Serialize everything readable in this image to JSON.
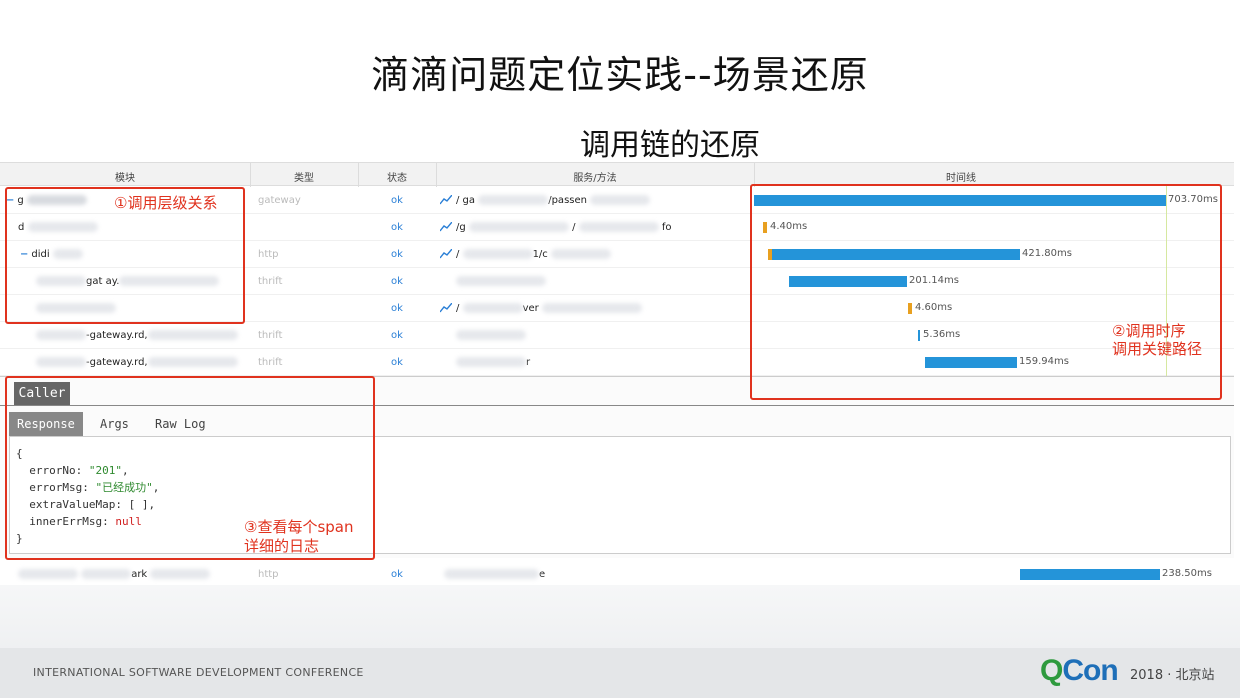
{
  "slide": {
    "title": "滴滴问题定位实践--场景还原",
    "subtitle": "调用链的还原"
  },
  "table": {
    "columns": [
      "模块",
      "类型",
      "状态",
      "服务/方法",
      "时间线"
    ],
    "rows": [
      {
        "module": "g",
        "type": "gateway",
        "status": "ok",
        "service": "/ ga",
        "service_end": "/passen",
        "duration": "703.70ms",
        "has_icon": true
      },
      {
        "module": "d",
        "type": "",
        "status": "ok",
        "service": "/g",
        "service_end": "fo",
        "duration": "4.40ms",
        "has_icon": true
      },
      {
        "module": "didi",
        "type": "http",
        "status": "ok",
        "service": "/",
        "service_end": "1/c",
        "duration": "421.80ms",
        "has_icon": true
      },
      {
        "module": "gat  ay.",
        "type": "thrift",
        "status": "ok",
        "service": "",
        "service_end": "",
        "duration": "201.14ms",
        "has_icon": false
      },
      {
        "module": "",
        "type": "",
        "status": "ok",
        "service": "/",
        "service_end": "ver",
        "duration": "4.60ms",
        "has_icon": true
      },
      {
        "module": "-gateway.rd,",
        "type": "thrift",
        "status": "ok",
        "service": "",
        "service_end": "",
        "duration": "5.36ms",
        "has_icon": false
      },
      {
        "module": "-gateway.rd,",
        "type": "thrift",
        "status": "ok",
        "service": "",
        "service_end": "r",
        "duration": "159.94ms",
        "has_icon": false
      }
    ],
    "last_row": {
      "module": "ark",
      "type": "http",
      "status": "ok",
      "service": "e",
      "duration": "238.50ms"
    }
  },
  "annotations": {
    "one": "①调用层级关系",
    "two_line1": "②调用时序",
    "two_line2": "调用关键路径",
    "three_line1": "③查看每个span",
    "three_line2": "详细的日志"
  },
  "detail": {
    "caller_tab": "Caller",
    "tabs": [
      "Response",
      "Args",
      "Raw Log"
    ],
    "code": {
      "open": "{",
      "k1": "  errorNo: ",
      "v1": "\"201\"",
      "c1": ",",
      "k2": "  errorMsg: ",
      "v2": "\"已经成功\"",
      "c2": ",",
      "k3": "  extraValueMap: [ ],",
      "k4": "  innerErrMsg: ",
      "v4": "null",
      "close": "}"
    }
  },
  "footer": {
    "left": "INTERNATIONAL SOFTWARE DEVELOPMENT CONFERENCE",
    "logo_q": "Q",
    "logo_con": "Con",
    "right": "2018 · 北京站"
  },
  "colors": {
    "bar": "#2494d9",
    "annotation": "#e0321e",
    "status": "#2a7fd6",
    "logo_green": "#2e9a3e"
  }
}
